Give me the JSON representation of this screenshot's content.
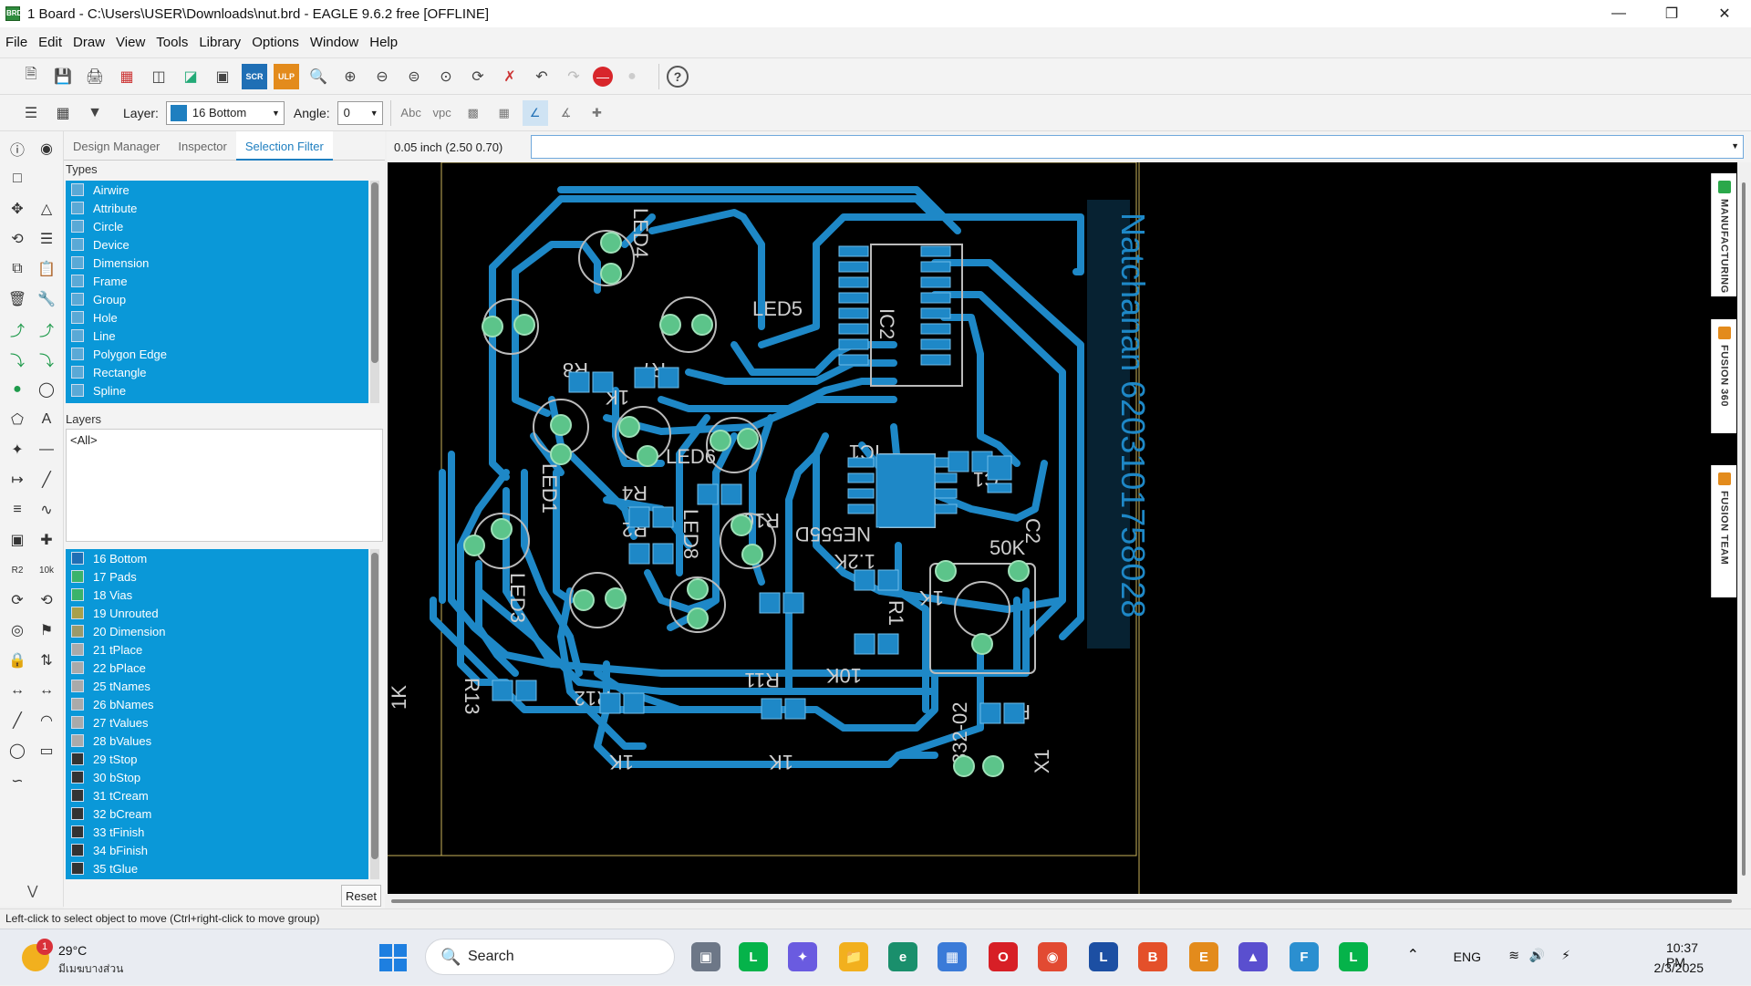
{
  "window": {
    "title": "1 Board - C:\\Users\\USER\\Downloads\\nut.brd - EAGLE 9.6.2 free [OFFLINE]",
    "app_icon": "BRD"
  },
  "menu": [
    "File",
    "Edit",
    "Draw",
    "View",
    "Tools",
    "Library",
    "Options",
    "Window",
    "Help"
  ],
  "toolbar": {
    "scr_label": "SCR",
    "ulp_label": "ULP",
    "help_label": "?"
  },
  "toolbar2": {
    "layer_label": "Layer:",
    "layer_value": "16 Bottom",
    "layer_color": "#1f7fc0",
    "angle_label": "Angle:",
    "angle_value": "0",
    "abc_label": "Abc",
    "vpc_label": "vpc"
  },
  "panel": {
    "tabs": [
      "Design Manager",
      "Inspector",
      "Selection Filter"
    ],
    "active_tab": "Selection Filter",
    "types_label": "Types",
    "types": [
      "Airwire",
      "Attribute",
      "Circle",
      "Device",
      "Dimension",
      "Frame",
      "Group",
      "Hole",
      "Line",
      "Polygon Edge",
      "Rectangle",
      "Spline"
    ],
    "layers_label": "Layers",
    "layers_filter": "<All>",
    "layer_list": [
      {
        "name": "16 Bottom",
        "color": "#1f6fb5"
      },
      {
        "name": "17 Pads",
        "color": "#3bb36b"
      },
      {
        "name": "18 Vias",
        "color": "#3bb36b"
      },
      {
        "name": "19 Unrouted",
        "color": "#a8a04a"
      },
      {
        "name": "20 Dimension",
        "color": "#9a9a6a"
      },
      {
        "name": "21 tPlace",
        "color": "#aaaaaa"
      },
      {
        "name": "22 bPlace",
        "color": "#aaaaaa"
      },
      {
        "name": "25 tNames",
        "color": "#aaaaaa"
      },
      {
        "name": "26 bNames",
        "color": "#aaaaaa"
      },
      {
        "name": "27 tValues",
        "color": "#aaaaaa"
      },
      {
        "name": "28 bValues",
        "color": "#aaaaaa"
      },
      {
        "name": "29 tStop",
        "color": "#333333"
      },
      {
        "name": "30 bStop",
        "color": "#333333"
      },
      {
        "name": "31 tCream",
        "color": "#333333"
      },
      {
        "name": "32 bCream",
        "color": "#333333"
      },
      {
        "name": "33 tFinish",
        "color": "#333333"
      },
      {
        "name": "34 bFinish",
        "color": "#333333"
      },
      {
        "name": "35 tGlue",
        "color": "#333333"
      }
    ],
    "reset_label": "Reset"
  },
  "coord": "0.05 inch (2.50 0.70)",
  "board": {
    "text": "Natchanan 6203101758028",
    "labels": [
      "LED4",
      "LED5",
      "LED6",
      "LED8",
      "LED1",
      "LED3",
      "R8",
      "R7",
      "R4",
      "R2",
      "R10",
      "R11",
      "R12",
      "R3",
      "R1",
      "IC1",
      "IC2",
      "C2",
      "C1",
      "NE555D",
      "50K",
      "1.2K",
      "10K",
      "1K",
      "1K",
      "1K",
      "1K",
      "332-02",
      "X1",
      "R13",
      "1K"
    ]
  },
  "sidetabs": [
    "MANUFACTURING",
    "FUSION 360",
    "FUSION TEAM"
  ],
  "status": "Left-click to select object to move (Ctrl+right-click to move group)",
  "taskbar": {
    "weather_temp": "29°C",
    "weather_cond": "มีเมฆบางส่วน",
    "weather_badge": "1",
    "search": "Search",
    "lang": "ENG",
    "time": "10:37 PM",
    "date": "2/3/2025"
  }
}
